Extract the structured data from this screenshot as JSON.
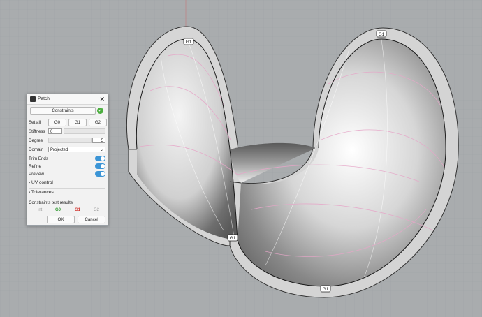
{
  "dialog": {
    "title": "Patch",
    "close_glyph": "✕",
    "constraints_button": "Constraints",
    "set_all_label": "Set all",
    "set_all_buttons": [
      "G0",
      "G1",
      "G2"
    ],
    "stiffness_label": "Stiffness",
    "stiffness_value": "0",
    "degree_label": "Degree",
    "degree_value": "5",
    "domain_label": "Domain",
    "domain_value": "Projected",
    "trim_ends_label": "Trim Ends",
    "refine_label": "Refine",
    "preview_label": "Preview",
    "uv_control_label": "UV control",
    "tolerances_label": "Tolerances",
    "results_title": "Constraints test results",
    "results": [
      {
        "label": "Int",
        "color": "#9a9a9a"
      },
      {
        "label": "G0",
        "color": "#2e9a2e"
      },
      {
        "label": "G1",
        "color": "#d0302a"
      },
      {
        "label": "G2",
        "color": "#9a9a9a"
      }
    ],
    "ok_label": "OK",
    "cancel_label": "Cancel"
  },
  "viewport": {
    "markers": [
      "G1",
      "G1",
      "G1",
      "G1"
    ],
    "background_color": "#a9acae",
    "grid_color": "#9ea2a5",
    "edge_color": "#1a1a1a",
    "isocurve_color": "#e6a6c8"
  },
  "icons": {
    "title_icon": "patch-icon",
    "status_icon": "check-circle-icon",
    "chevron": "chevron-right-icon",
    "dropdown": "chevron-down-icon"
  }
}
